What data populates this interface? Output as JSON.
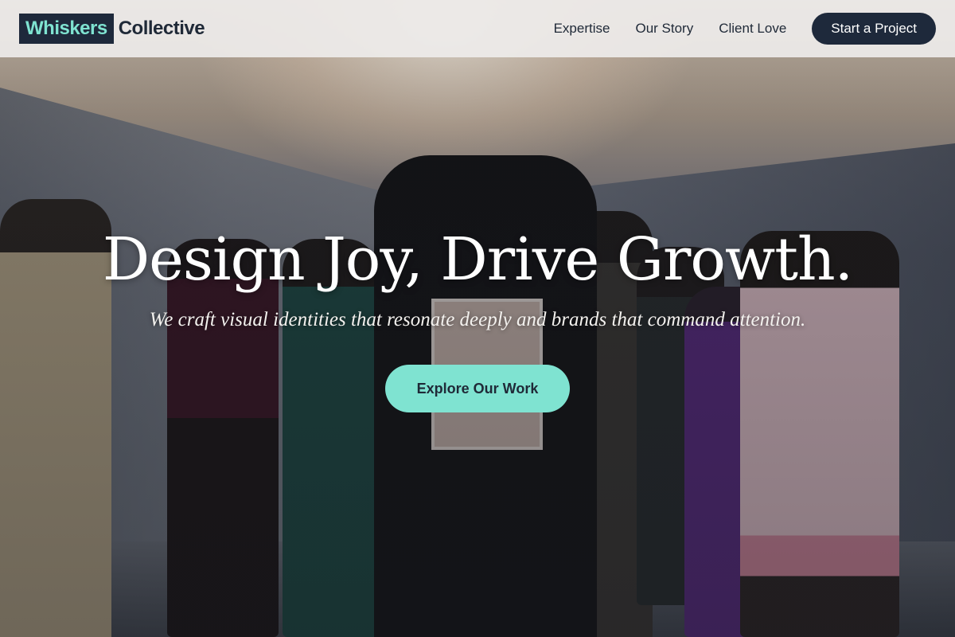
{
  "brand": {
    "highlight": "Whiskers",
    "rest": "Collective"
  },
  "nav": {
    "items": [
      {
        "label": "Expertise"
      },
      {
        "label": "Our Story"
      },
      {
        "label": "Client Love"
      }
    ],
    "cta_label": "Start a Project"
  },
  "hero": {
    "headline": "Design Joy, Drive Growth.",
    "subheadline": "We craft visual identities that resonate deeply and brands that command attention.",
    "button_label": "Explore Our Work"
  },
  "colors": {
    "primary_dark": "#1e293b",
    "accent_mint": "#7fe3d1",
    "nav_background": "#eeecea"
  }
}
